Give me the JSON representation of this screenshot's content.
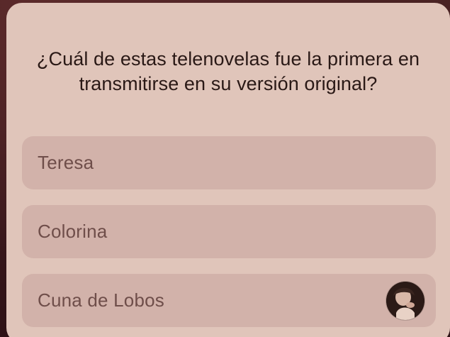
{
  "quiz": {
    "question": "¿Cuál de estas telenovelas fue la primera en transmitirse en su versión original?",
    "options": [
      {
        "label": "Teresa"
      },
      {
        "label": "Colorina"
      },
      {
        "label": "Cuna de Lobos"
      }
    ]
  },
  "colors": {
    "card_background": "#e0c5ba",
    "option_background": "#d2b2aa",
    "question_text": "#2a1916",
    "option_text": "#6f4e4a"
  },
  "icons": {
    "avatar": "user-avatar-photo"
  }
}
